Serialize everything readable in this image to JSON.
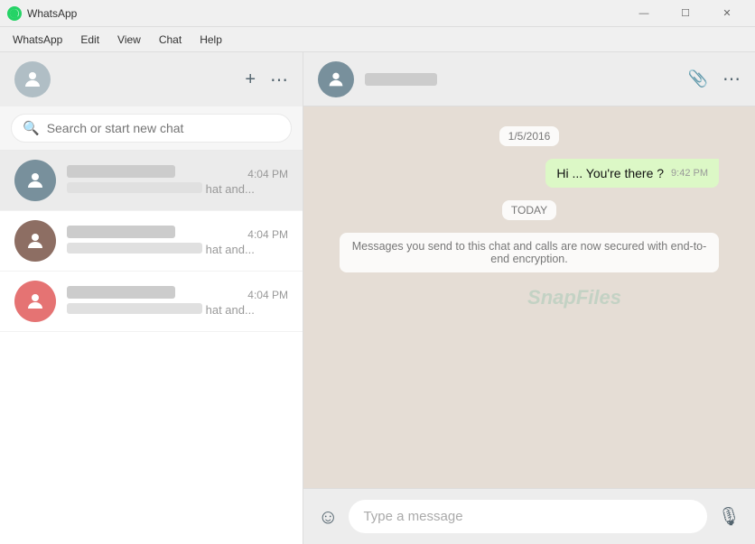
{
  "titlebar": {
    "icon": "●",
    "title": "WhatsApp",
    "minimize": "—",
    "maximize": "☐",
    "close": "✕"
  },
  "menubar": {
    "items": [
      "WhatsApp",
      "Edit",
      "View",
      "Chat",
      "Help"
    ]
  },
  "left_header": {
    "new_chat_icon": "+",
    "menu_icon": "⋯"
  },
  "search": {
    "placeholder": "Search or start new chat",
    "icon": "🔍"
  },
  "chats": [
    {
      "id": "1",
      "time": "4:04 PM",
      "preview": "hat and..."
    },
    {
      "id": "2",
      "time": "4:04 PM",
      "preview": "hat and..."
    },
    {
      "id": "3",
      "time": "4:04 PM",
      "preview": "hat and..."
    }
  ],
  "active_chat": {
    "header_menu_icon": "⋯",
    "attach_icon": "📎"
  },
  "messages": [
    {
      "type": "date",
      "text": "1/5/2016"
    },
    {
      "type": "sent",
      "text": "Hi ... You're there ?",
      "time": "9:42 PM"
    },
    {
      "type": "date",
      "text": "TODAY"
    },
    {
      "type": "info",
      "text": "Messages you send to this chat and calls are now secured with end-to-end encryption."
    }
  ],
  "input": {
    "placeholder": "Type a message",
    "emoji_icon": "☺",
    "mic_icon": "🎙"
  },
  "watermark": "SnapFiles"
}
